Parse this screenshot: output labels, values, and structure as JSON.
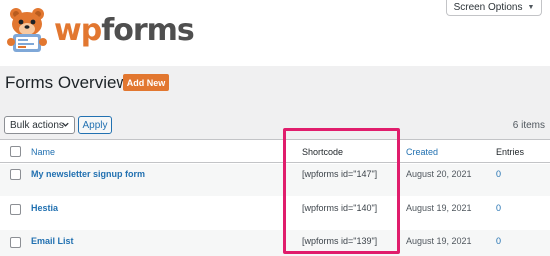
{
  "brand": {
    "wp": "wp",
    "forms": "forms",
    "accent": "#e27730",
    "logo_icon": "bear-mascot-icon"
  },
  "header": {
    "screen_options_label": "Screen Options",
    "caret": "▼"
  },
  "page": {
    "title": "Forms Overview",
    "add_new_label": "Add New"
  },
  "toolbar": {
    "bulk_actions_label": "Bulk actions",
    "apply_label": "Apply",
    "items_count": "6 items"
  },
  "table": {
    "columns": [
      "Name",
      "Shortcode",
      "Created",
      "Entries"
    ],
    "rows": [
      {
        "name": "My newsletter signup form",
        "shortcode": "[wpforms id=\"147\"]",
        "created": "August 20, 2021",
        "entries": "0"
      },
      {
        "name": "Hestia",
        "shortcode": "[wpforms id=\"140\"]",
        "created": "August 19, 2021",
        "entries": "0"
      },
      {
        "name": "Email List",
        "shortcode": "[wpforms id=\"139\"]",
        "created": "August 19, 2021",
        "entries": "0"
      }
    ]
  },
  "highlight_color": "#e01d6c"
}
